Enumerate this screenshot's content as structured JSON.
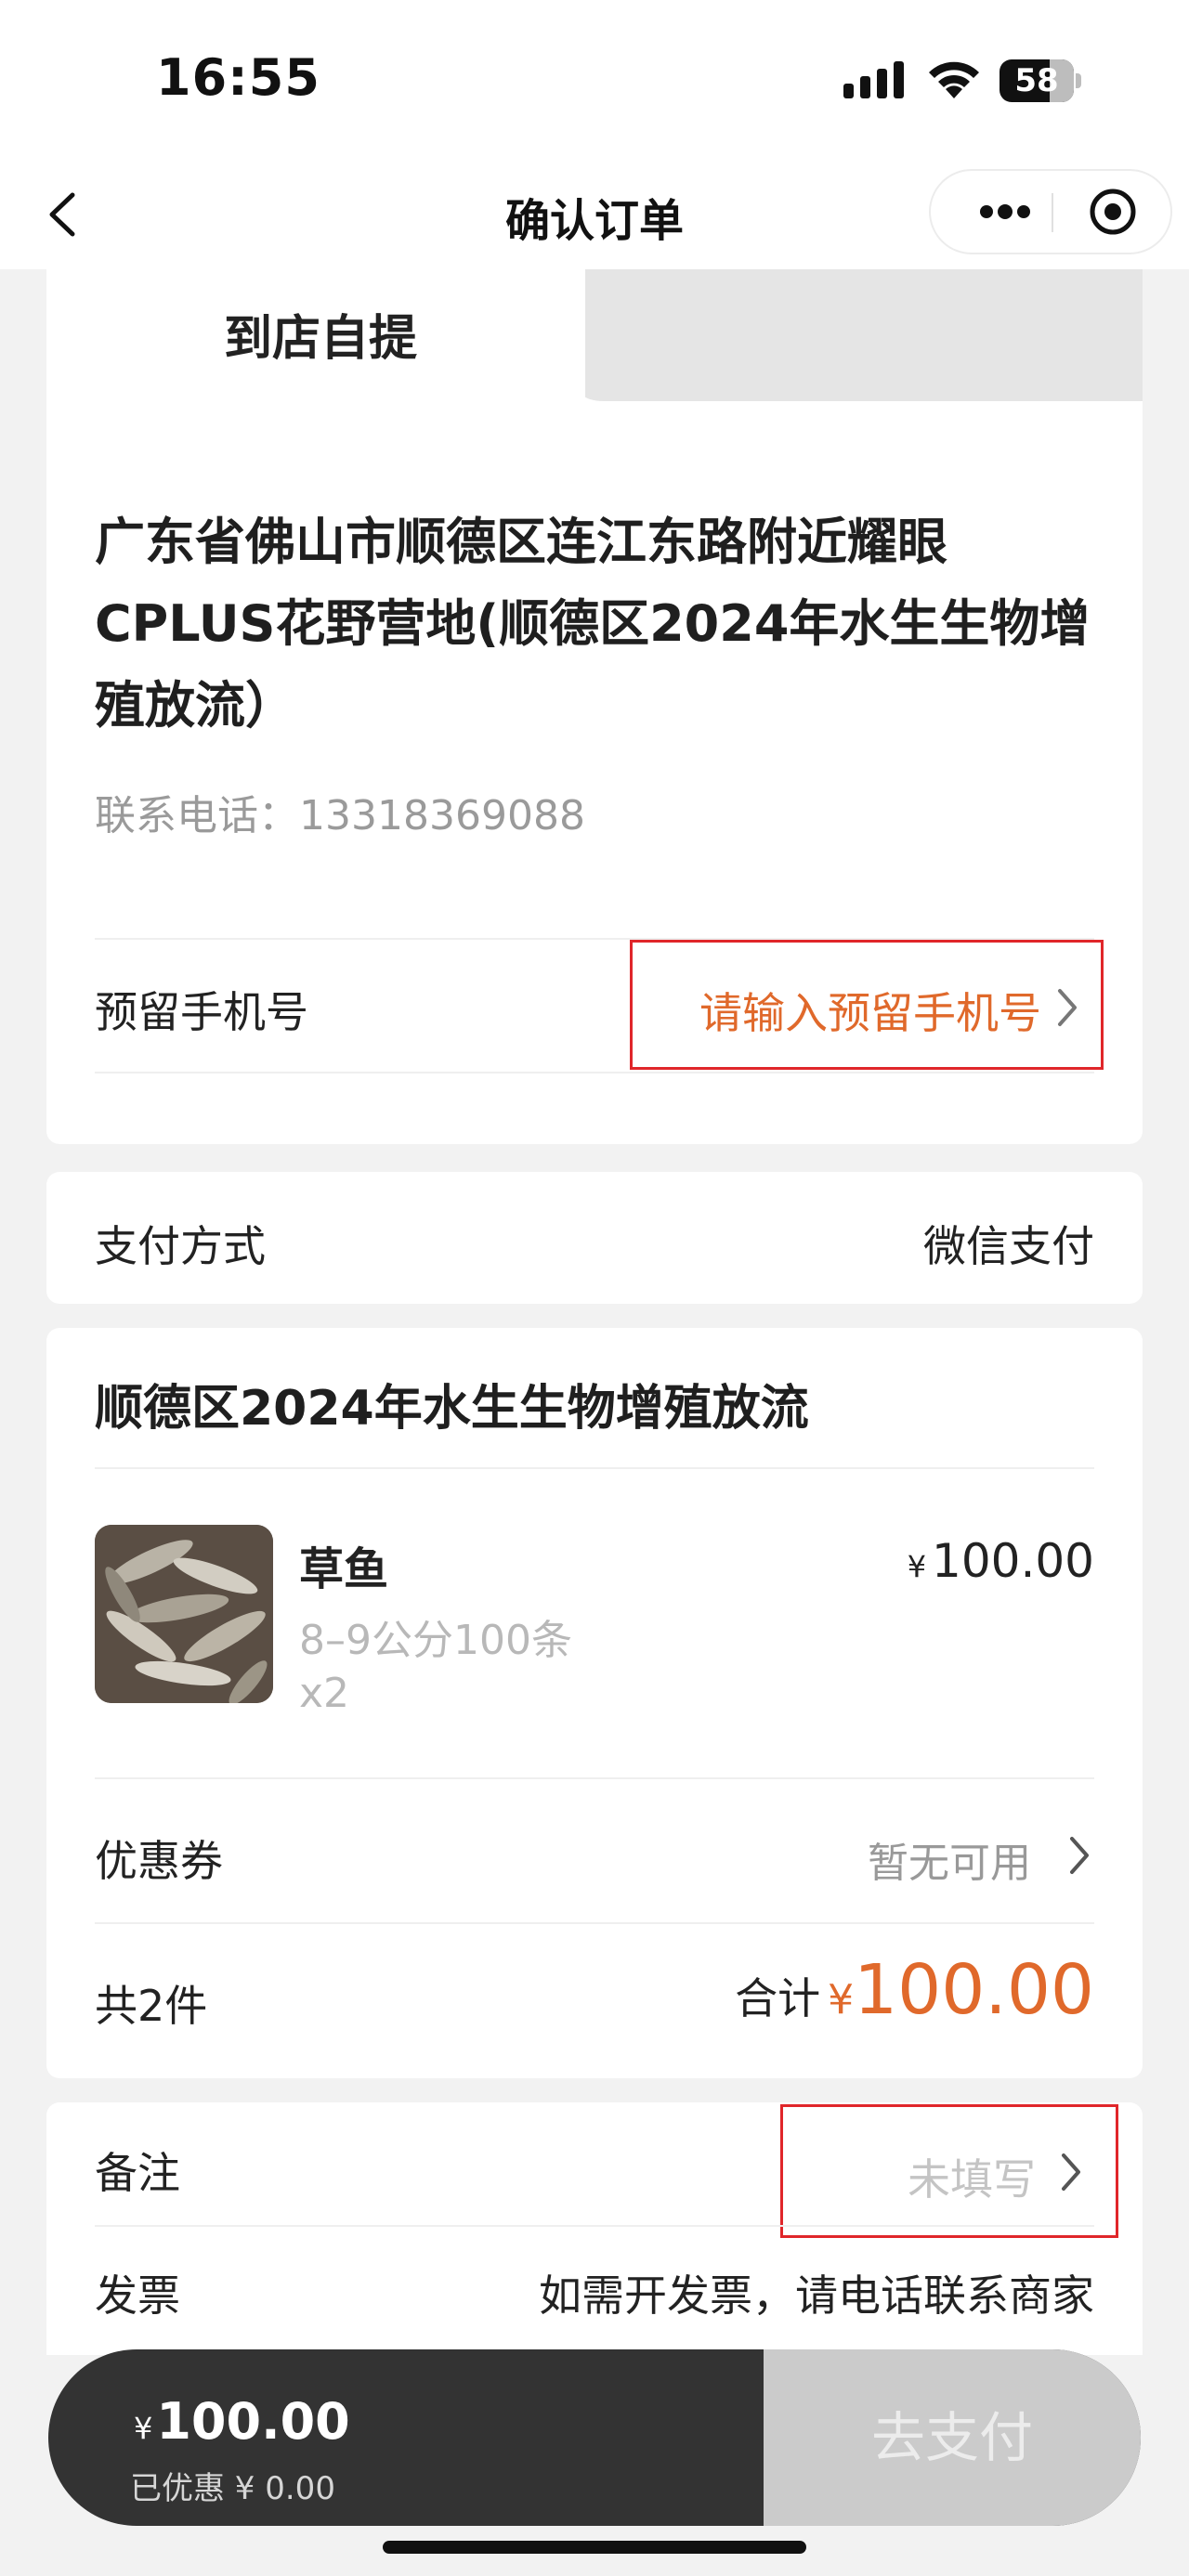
{
  "status_bar": {
    "time": "16:55",
    "battery": "58"
  },
  "nav": {
    "title": "确认订单"
  },
  "tabs": {
    "active": "到店自提"
  },
  "pickup": {
    "address": "广东省佛山市顺德区连江东路附近耀眼CPLUS花野营地(顺德区2024年水生生物增殖放流）",
    "contact": "联系电话：13318369088",
    "reserved_phone_label": "预留手机号",
    "reserved_phone_placeholder": "请输入预留手机号"
  },
  "payment": {
    "label": "支付方式",
    "value": "微信支付"
  },
  "order": {
    "store_name": "顺德区2024年水生生物增殖放流",
    "item": {
      "name": "草鱼",
      "spec": "8–9公分100条",
      "qty": "x2",
      "currency": "¥",
      "price": "100.00"
    },
    "coupon_label": "优惠券",
    "coupon_value": "暂无可用",
    "count_label": "共2件",
    "total_label": "合计",
    "total_currency": "¥",
    "total_amount": "100.00"
  },
  "extra": {
    "remark_label": "备注",
    "remark_placeholder": "未填写",
    "invoice_label": "发票",
    "invoice_note": "如需开发票，请电话联系商家"
  },
  "bottom": {
    "currency": "¥",
    "amount": "100.00",
    "discount": "已优惠 ¥ 0.00",
    "pay_button": "去支付"
  },
  "colors": {
    "accent": "#e0692b",
    "highlight_border": "#e0262a",
    "bottom_bar": "#333333",
    "pay_button_disabled": "#cbcbcb"
  }
}
